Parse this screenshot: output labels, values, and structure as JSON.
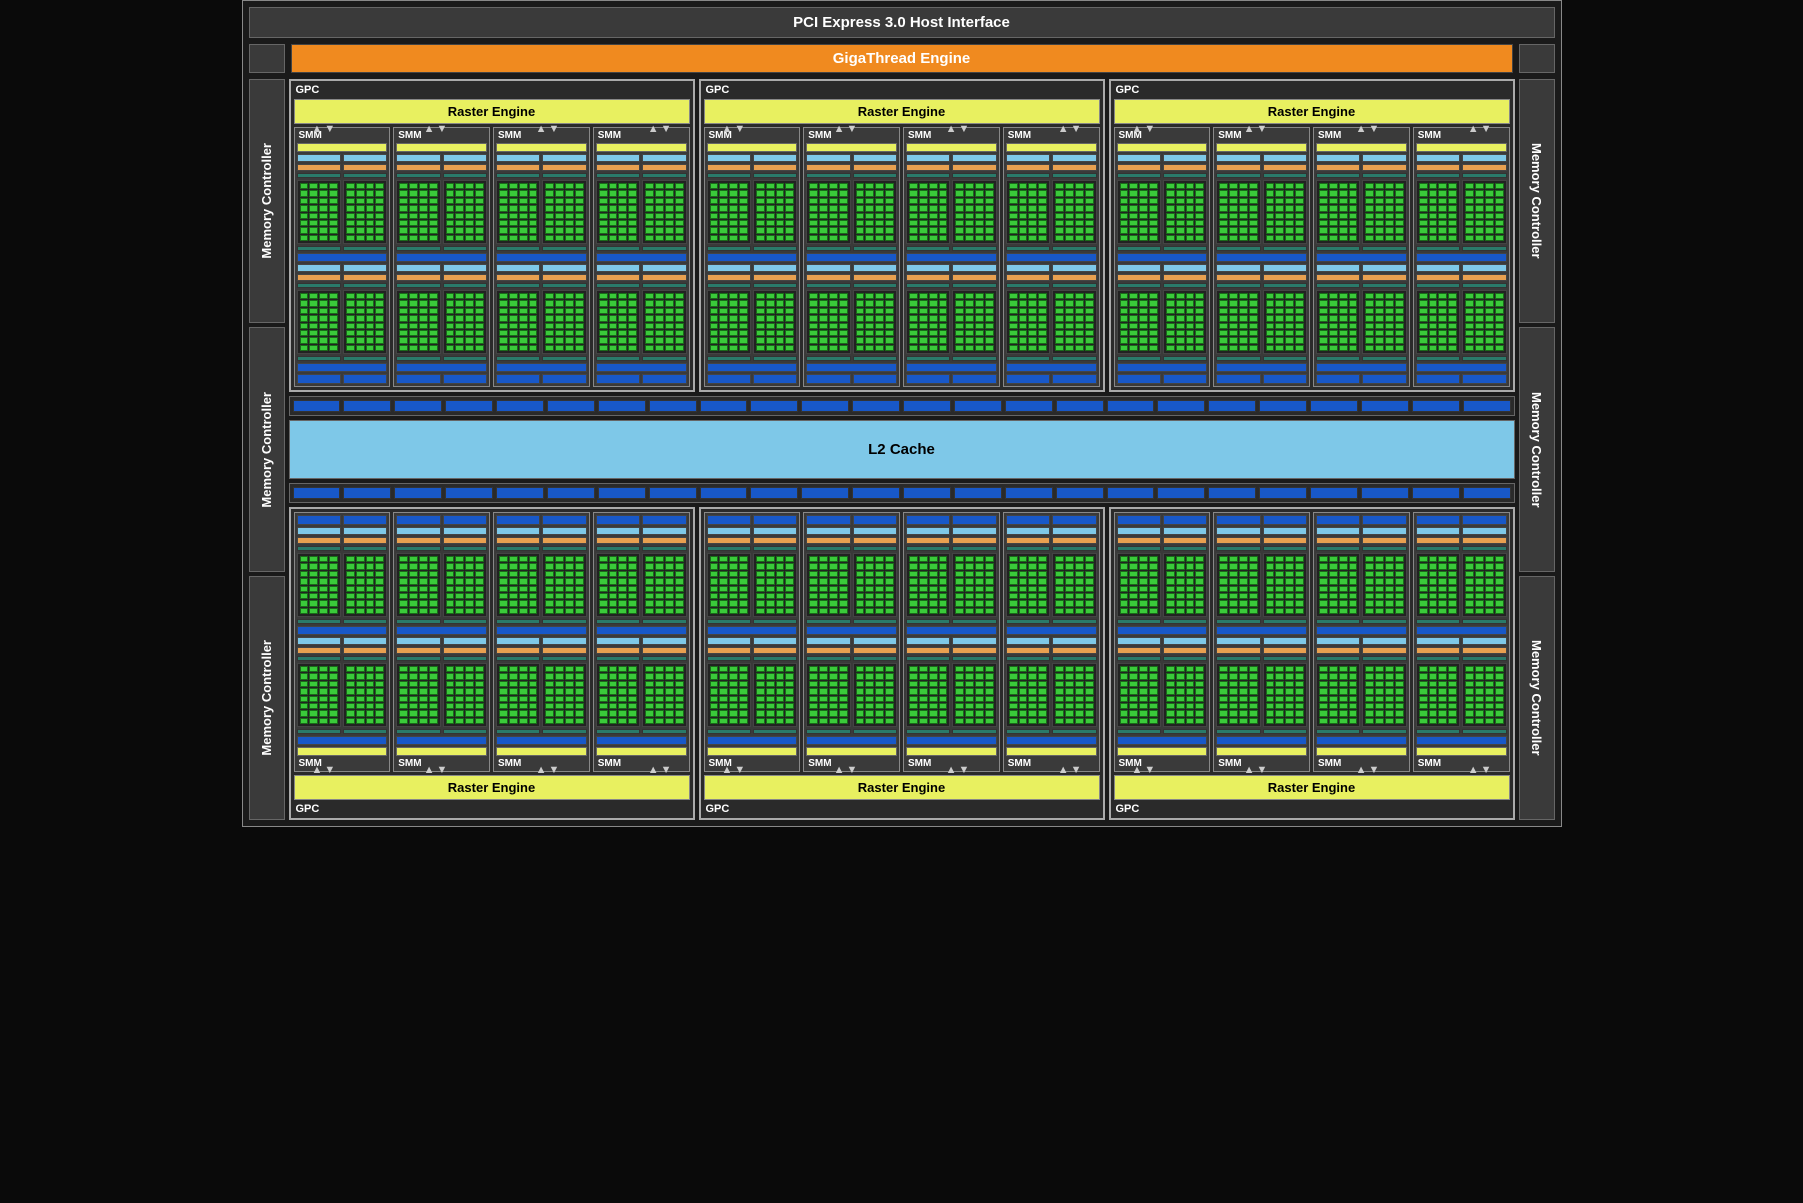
{
  "pcie": "PCI Express 3.0 Host Interface",
  "gigathread": "GigaThread Engine",
  "mc": "Memory Controller",
  "gpc": "GPC",
  "raster": "Raster Engine",
  "smm": "SMM",
  "l2": "L2 Cache",
  "layout": {
    "gpc_rows": 2,
    "gpcs_per_row": 3,
    "smms_per_gpc": 4,
    "memory_controllers_per_side": 3,
    "cores_per_block_grid": "4x8",
    "core_blocks_per_smm": 4,
    "blue_strip_segments": 24
  },
  "colors": {
    "orange": "#f08a1f",
    "yellow": "#e8f060",
    "green": "#3aca3a",
    "sky": "#7ec8e8",
    "blue": "#1858c8",
    "teal": "#2a7a6a",
    "barorange": "#e8a050"
  }
}
